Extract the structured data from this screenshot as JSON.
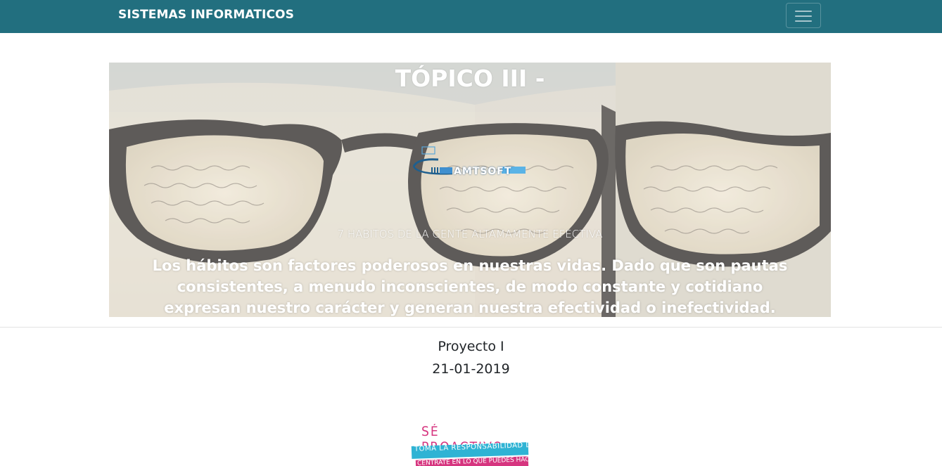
{
  "navbar": {
    "brand": "SISTEMAS INFORMATICOS",
    "menu_icon": "hamburger-menu-icon",
    "color": "#226f7f"
  },
  "hero": {
    "title": "TÓPICO III -",
    "logo_text": "AMTSOFT",
    "subtitle": "7 HABITOS DE LA GENTE ALTAMAMENTE EFECTIVA",
    "description": "Los hábitos son factores poderosos en nuestras vidas. Dado que son pautas consistentes, a menudo inconscientes, de modo constante y cotidiano expresan nuestro carácter y generan nuestra efectividad o inefectividad."
  },
  "project": {
    "name": "Proyecto I",
    "date": "21-01-2019"
  },
  "poster": {
    "title": "SÉ PROACTIVO:",
    "line1": "TOMA LA RESPONSABILIDAD DE TU VIDA,",
    "line2": "CENTRATE EN LO QUE PUEDES HACER Y"
  }
}
